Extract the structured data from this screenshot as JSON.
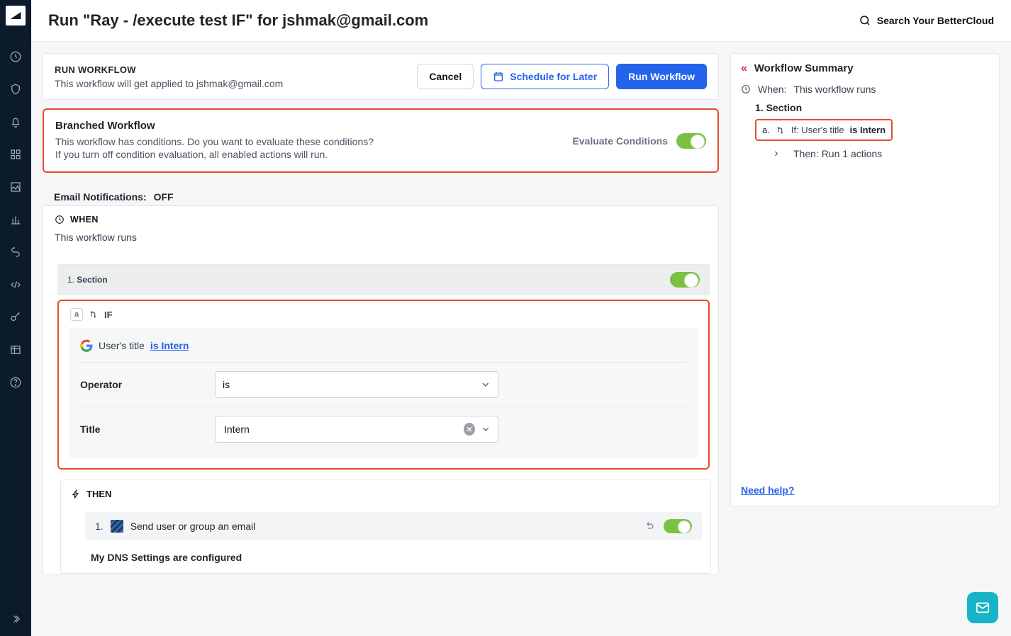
{
  "header": {
    "title": "Run \"Ray - /execute test IF\" for jshmak@gmail.com",
    "search_label": "Search Your BetterCloud"
  },
  "run_header": {
    "title": "RUN WORKFLOW",
    "subtitle": "This workflow will get applied to jshmak@gmail.com",
    "cancel": "Cancel",
    "schedule": "Schedule for Later",
    "run": "Run Workflow"
  },
  "branched": {
    "title": "Branched Workflow",
    "line1": "This workflow has conditions. Do you want to evaluate these conditions?",
    "line2": "If you turn off condition evaluation, all enabled actions will run.",
    "eval_label": "Evaluate Conditions"
  },
  "email_notifications": {
    "label": "Email Notifications:",
    "state": "OFF"
  },
  "when": {
    "label": "WHEN",
    "desc": "This workflow runs"
  },
  "section": {
    "num": "1.",
    "label": "Section"
  },
  "condition": {
    "if_label": "IF",
    "badge": "a",
    "text_prefix": "User's title ",
    "link": "is Intern",
    "operator_label": "Operator",
    "operator_value": "is",
    "title_label": "Title",
    "title_value": "Intern"
  },
  "then": {
    "label": "THEN",
    "item_num": "1.",
    "item_text": "Send user or group an email",
    "config_title": "My DNS Settings are configured"
  },
  "summary": {
    "title": "Workflow Summary",
    "when_label": "When:",
    "when_value": "This workflow runs",
    "section": "1. Section",
    "cond_prefix": "a.",
    "cond_label": "If: User's title",
    "cond_value": "is Intern",
    "then": "Then: Run 1 actions",
    "help": "Need help?"
  }
}
